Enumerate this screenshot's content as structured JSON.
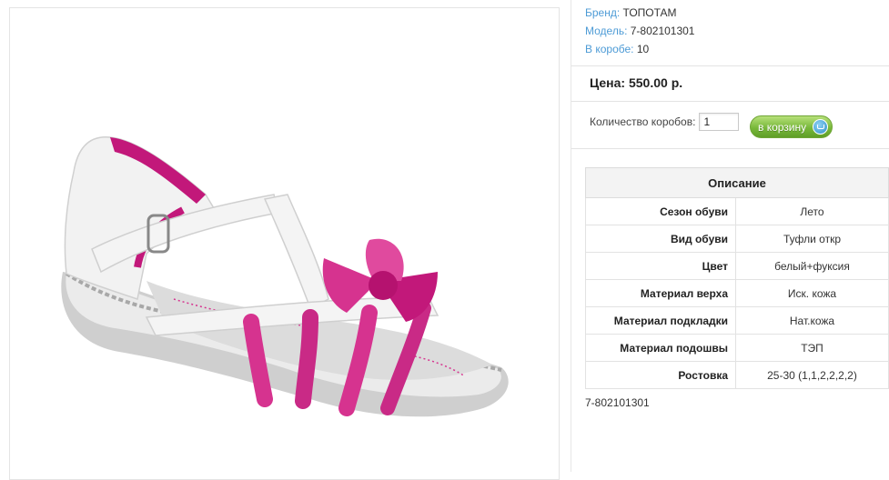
{
  "product": {
    "brand_label": "Бренд:",
    "brand": "ТОПОТАМ",
    "model_label": "Модель:",
    "model": "7-802101301",
    "box_label": "В коробе:",
    "box_count": "10",
    "price": "Цена: 550.00 р.",
    "qty_label": "Количество коробов:",
    "qty_value": "1",
    "cart_label": "в корзину",
    "sku": "7-802101301",
    "image_alt": "Сандалии белые с фуксией"
  },
  "description": {
    "title": "Описание",
    "rows": [
      {
        "key": "Сезон обуви",
        "value": "Лето"
      },
      {
        "key": "Вид обуви",
        "value": "Туфли откр"
      },
      {
        "key": "Цвет",
        "value": "белый+фуксия"
      },
      {
        "key": "Материал верха",
        "value": "Иск. кожа"
      },
      {
        "key": "Материал подкладки",
        "value": "Нат.кожа"
      },
      {
        "key": "Материал подошвы",
        "value": "ТЭП"
      },
      {
        "key": "Ростовка",
        "value": "25-30 (1,1,2,2,2,2)"
      }
    ]
  },
  "colors": {
    "accent": "#4d9bd6",
    "fuchsia": "#d6338f",
    "button": "#78b83a"
  }
}
